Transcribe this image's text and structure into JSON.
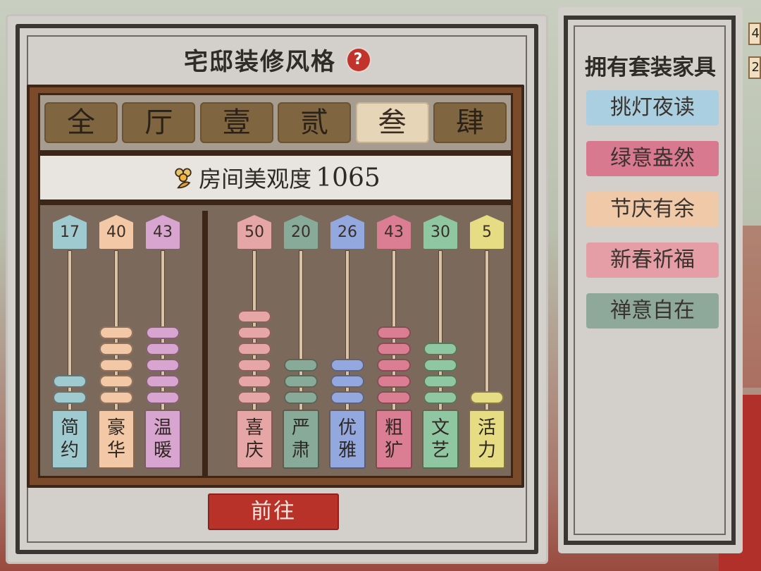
{
  "panel": {
    "title": "宅邸装修风格",
    "help_symbol": "?"
  },
  "tabs": [
    {
      "label": "全",
      "active": false
    },
    {
      "label": "厅",
      "active": false
    },
    {
      "label": "壹",
      "active": false
    },
    {
      "label": "贰",
      "active": false
    },
    {
      "label": "叁",
      "active": true
    },
    {
      "label": "肆",
      "active": false
    }
  ],
  "beauty": {
    "label": "房间美观度",
    "value": "1065"
  },
  "styles": [
    {
      "value": "17",
      "beads": 2,
      "name1": "简",
      "name2": "约",
      "color": "#9fcbd0",
      "bead_color": "#9fcbd0"
    },
    {
      "value": "40",
      "beads": 5,
      "name1": "豪",
      "name2": "华",
      "color": "#f2c8a6",
      "bead_color": "#f2c8a6"
    },
    {
      "value": "43",
      "beads": 5,
      "name1": "温",
      "name2": "暖",
      "color": "#d7a5cf",
      "bead_color": "#d7a5cf"
    },
    {
      "value": "50",
      "beads": 6,
      "name1": "喜",
      "name2": "庆",
      "color": "#e7a6a6",
      "bead_color": "#e7a6a6"
    },
    {
      "value": "20",
      "beads": 3,
      "name1": "严",
      "name2": "肃",
      "color": "#88aa99",
      "bead_color": "#88aa99"
    },
    {
      "value": "26",
      "beads": 3,
      "name1": "优",
      "name2": "雅",
      "color": "#92a8de",
      "bead_color": "#92a8de"
    },
    {
      "value": "43",
      "beads": 5,
      "name1": "粗",
      "name2": "犷",
      "color": "#dc7e93",
      "bead_color": "#dc7e93"
    },
    {
      "value": "30",
      "beads": 4,
      "name1": "文",
      "name2": "艺",
      "color": "#8ec7a2",
      "bead_color": "#8ec7a2"
    },
    {
      "value": "5",
      "beads": 1,
      "name1": "活",
      "name2": "力",
      "color": "#e6dc83",
      "bead_color": "#e6dc83"
    }
  ],
  "go_button": "前往",
  "side": {
    "title": "拥有套装家具",
    "sets": [
      {
        "label": "挑灯夜读",
        "color": "#a9cfe0"
      },
      {
        "label": "绿意盎然",
        "color": "#d87990"
      },
      {
        "label": "节庆有余",
        "color": "#efc9a8"
      },
      {
        "label": "新春祈福",
        "color": "#e69ea6"
      },
      {
        "label": "禅意自在",
        "color": "#8ea99a"
      }
    ]
  },
  "edge_counters": [
    "4",
    "2"
  ]
}
